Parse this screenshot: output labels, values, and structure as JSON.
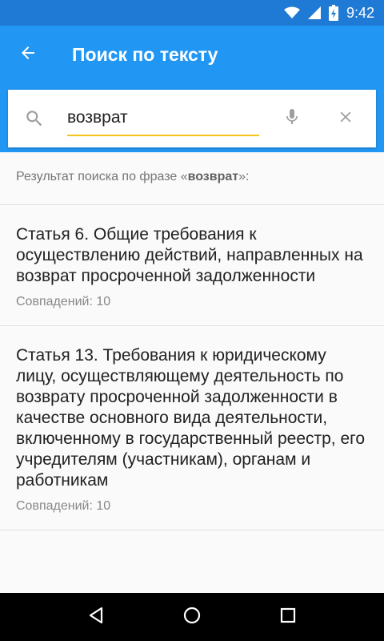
{
  "status_bar": {
    "time": "9:42",
    "icons": [
      "wifi-icon",
      "signal-icon",
      "battery-charging-icon"
    ]
  },
  "app_bar": {
    "title": "Поиск по тексту",
    "back_icon": "arrow-back-icon"
  },
  "search": {
    "value": "возврат",
    "placeholder": "",
    "icons": [
      "search-icon",
      "mic-icon",
      "close-icon"
    ],
    "underline_color": "#f5c518"
  },
  "results_header": {
    "prefix": "Результат поиска по фразе «",
    "query": "возврат",
    "suffix": "»:"
  },
  "results": [
    {
      "title": "Статья 6. Общие требования к осуществлению действий, направленных на возврат просроченной задолженности",
      "count": "Совпадений: 10"
    },
    {
      "title": "Статья 13. Требования к юридическому лицу, осуществляющему деятельность по возврату просроченной задолженности в качестве основного вида деятельности, включенному в государственный реестр, его учредителям (участникам), органам и работникам",
      "count": "Совпадений: 10"
    }
  ],
  "nav_bar": {
    "icons": [
      "back-triangle-icon",
      "home-circle-icon",
      "recents-square-icon"
    ]
  },
  "colors": {
    "primary": "#2196f3",
    "primary_dark": "#1f7ad6",
    "accent": "#f5c518"
  }
}
